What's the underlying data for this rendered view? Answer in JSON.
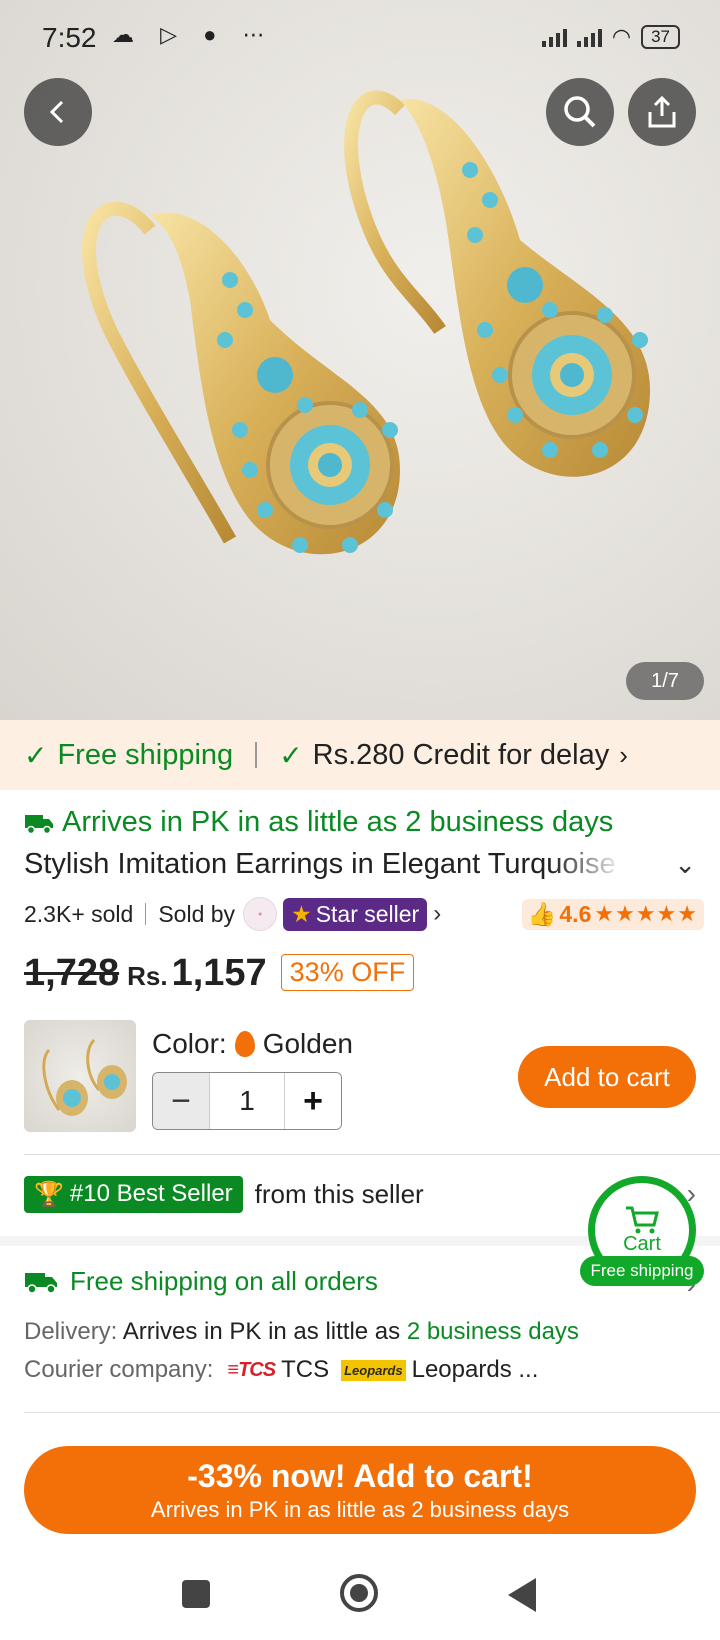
{
  "status_bar": {
    "time": "7:52",
    "battery": "37"
  },
  "gallery": {
    "counter": "1/7"
  },
  "shipping_banner": {
    "free_shipping": "Free shipping",
    "credit": "Rs.280 Credit for delay"
  },
  "product": {
    "arrives": "Arrives in PK in as little as 2 business days",
    "title": "Stylish Imitation Earrings in Elegant Turquoise",
    "sold": "2.3K+ sold",
    "sold_by": "Sold by",
    "seller_badge": "Star seller",
    "rating": "4.6",
    "old_price": "1,728",
    "currency": "Rs.",
    "price": "1,157",
    "discount": "33% OFF"
  },
  "variant": {
    "color_label": "Color:",
    "color_value": "Golden",
    "quantity": "1",
    "add_to_cart": "Add to cart"
  },
  "best_seller": {
    "badge": "#10 Best Seller",
    "text": "from this seller"
  },
  "floating_cart": {
    "label": "Cart",
    "ship": "Free shipping"
  },
  "shipping_info": {
    "title": "Free shipping on all orders",
    "delivery_label": "Delivery:",
    "delivery_text": "Arrives in PK in as little as",
    "delivery_highlight": "2 business days",
    "courier_label": "Courier company:",
    "courier_1": "TCS",
    "courier_2": "Leopards ..."
  },
  "cta": {
    "line1": "-33% now! Add to cart!",
    "line2": "Arrives in PK in as little as 2 business days"
  },
  "colors": {
    "accent": "#f36f08",
    "green": "#0b8a24",
    "star_seller": "#5b2a86"
  }
}
